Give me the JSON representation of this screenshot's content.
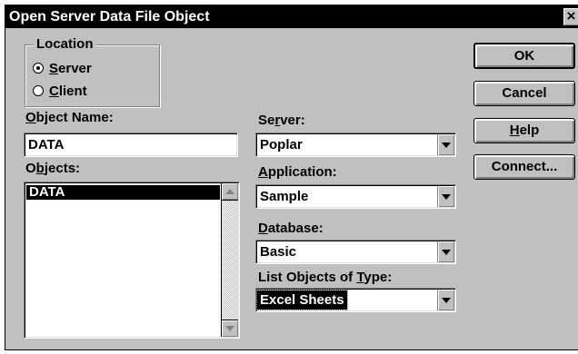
{
  "window": {
    "title": "Open Server Data File Object",
    "close_glyph": "×"
  },
  "location": {
    "label": "Location",
    "radios": [
      {
        "label_key": "S",
        "label_rest": "erver",
        "selected": true
      },
      {
        "label_key": "C",
        "label_rest": "lient",
        "selected": false
      }
    ]
  },
  "object_name": {
    "label_key": "O",
    "label_rest": "bject Name:",
    "value": "DATA"
  },
  "objects": {
    "label_pre": "O",
    "label_key": "b",
    "label_rest": "jects:",
    "items": [
      {
        "label": "DATA",
        "selected": true
      }
    ]
  },
  "server": {
    "label_pre": "Se",
    "label_key": "r",
    "label_rest": "ver:",
    "value": "Poplar"
  },
  "application": {
    "label_key": "A",
    "label_rest": "pplication:",
    "value": "Sample"
  },
  "database": {
    "label_key": "D",
    "label_rest": "atabase:",
    "value": "Basic"
  },
  "object_type": {
    "label_pre": "List Objects of ",
    "label_key": "T",
    "label_rest": "ype:",
    "value": "Excel Sheets",
    "value_selected": true
  },
  "buttons": {
    "ok": {
      "label": "OK",
      "default": true
    },
    "cancel": {
      "label": "Cancel"
    },
    "help": {
      "label_key": "H",
      "label_rest": "elp"
    },
    "connect": {
      "label": "Connect..."
    }
  },
  "icons": {
    "close": "close-icon",
    "combo_arrow": "chevron-down-icon",
    "scroll_up": "scroll-up-arrow-icon",
    "scroll_down": "scroll-down-arrow-icon",
    "radio": "radio-button-icon"
  },
  "colors": {
    "title_bar": "#000000",
    "title_text": "#ffffff",
    "face": "#c0c0c0",
    "field": "#ffffff",
    "selection": "#000000",
    "selection_text": "#ffffff"
  }
}
